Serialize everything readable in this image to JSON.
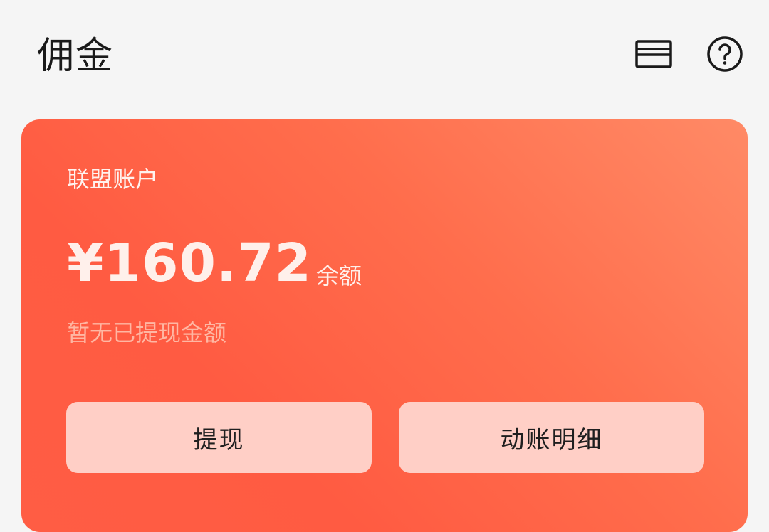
{
  "header": {
    "title": "佣金",
    "card_icon": "bank-card-icon",
    "help_icon": "help-icon"
  },
  "account": {
    "label": "联盟账户",
    "balance": "¥160.72",
    "balance_unit": "余额",
    "withdraw_status": "暂无已提现金额"
  },
  "actions": {
    "withdraw_label": "提现",
    "detail_label": "动账明细"
  },
  "colors": {
    "card_gradient_start": "#ff8a66",
    "card_gradient_end": "#ff5b42",
    "button_bg": "#ffcfc6",
    "background": "#f5f5f5"
  }
}
